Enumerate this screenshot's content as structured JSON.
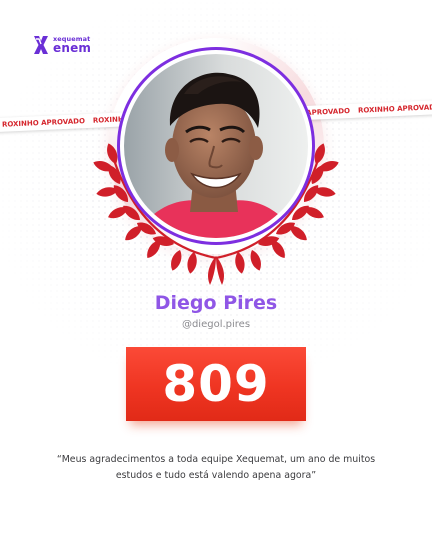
{
  "brand": {
    "logo_top": "xequemat",
    "logo_bottom": "enem",
    "icon": "xequemat-logo-icon",
    "color": "#6a2fd6"
  },
  "ribbon": {
    "text": "ROXINHO APROVADO",
    "color": "#d5262d"
  },
  "profile": {
    "name": "Diego Pires",
    "handle": "@diegol.pires",
    "photo": "student-portrait-photo",
    "ring_color": "#7d2ee0"
  },
  "score": {
    "value": "809",
    "color": "#ef3522"
  },
  "quote": "“Meus agradecimentos a toda equipe Xequemat, um ano de muitos estudos e tudo está valendo apena agora”",
  "colors": {
    "name": "#8f56e6",
    "laurel": "#d01f29"
  }
}
